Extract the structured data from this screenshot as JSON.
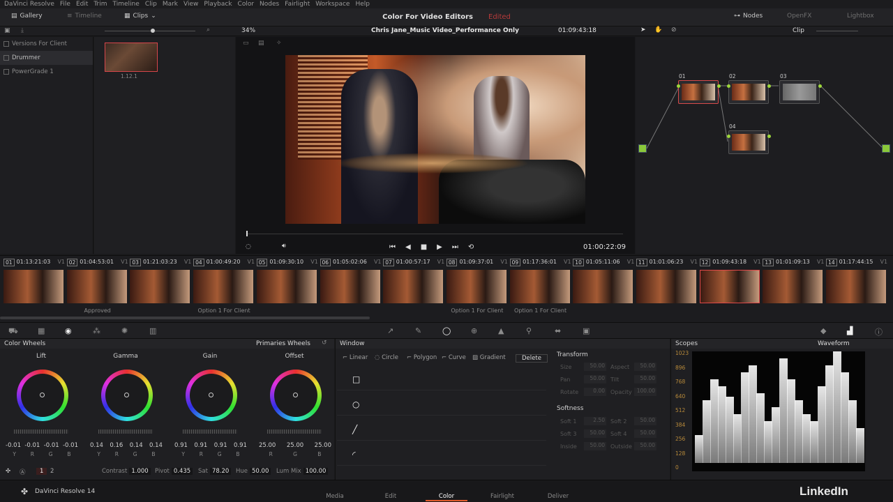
{
  "menubar": [
    "DaVinci Resolve",
    "File",
    "Edit",
    "Trim",
    "Timeline",
    "Clip",
    "Mark",
    "View",
    "Playback",
    "Color",
    "Nodes",
    "Fairlight",
    "Workspace",
    "Help"
  ],
  "toolbar": {
    "gallery": "Gallery",
    "timeline": "Timeline",
    "clips": "Clips",
    "project_title": "Color For Video Editors",
    "project_badge": "Edited",
    "nodes": "Nodes",
    "openfx": "OpenFX",
    "lightbox": "Lightbox"
  },
  "subbar": {
    "zoom": "34%",
    "timeline_name": "Chris Jane_Music Video_Performance Only",
    "timecode": "01:09:43:18",
    "node_mode": "Clip"
  },
  "gallery": {
    "albums": [
      "Versions For Client",
      "Drummer",
      "PowerGrade 1"
    ],
    "selected_album": "Drummer",
    "still_label": "1.12.1"
  },
  "viewer": {
    "timecode": "01:00:22:09"
  },
  "nodes": {
    "labels": [
      "01",
      "02",
      "03",
      "04"
    ]
  },
  "clips": [
    {
      "n": "01",
      "tc": "01:13:21:03",
      "v": "V1",
      "label": ""
    },
    {
      "n": "02",
      "tc": "01:04:53:01",
      "v": "V1",
      "label": "Approved"
    },
    {
      "n": "03",
      "tc": "01:21:03:23",
      "v": "V1",
      "label": ""
    },
    {
      "n": "04",
      "tc": "01:00:49:20",
      "v": "V1",
      "label": "Option 1 For Client"
    },
    {
      "n": "05",
      "tc": "01:09:30:10",
      "v": "V1",
      "label": ""
    },
    {
      "n": "06",
      "tc": "01:05:02:06",
      "v": "V1",
      "label": ""
    },
    {
      "n": "07",
      "tc": "01:00:57:17",
      "v": "V1",
      "label": ""
    },
    {
      "n": "08",
      "tc": "01:09:37:01",
      "v": "V1",
      "label": "Option 1 For Client"
    },
    {
      "n": "09",
      "tc": "01:17:36:01",
      "v": "V1",
      "label": "Option 1 For Client"
    },
    {
      "n": "10",
      "tc": "01:05:11:06",
      "v": "V1",
      "label": ""
    },
    {
      "n": "11",
      "tc": "01:01:06:23",
      "v": "V1",
      "label": ""
    },
    {
      "n": "12",
      "tc": "01:09:43:18",
      "v": "V1",
      "label": ""
    },
    {
      "n": "13",
      "tc": "01:01:09:13",
      "v": "V1",
      "label": ""
    },
    {
      "n": "14",
      "tc": "01:17:44:15",
      "v": "V1",
      "label": ""
    }
  ],
  "wheels_panel": {
    "title": "Color Wheels",
    "mode": "Primaries Wheels",
    "wheels": [
      {
        "name": "Lift",
        "values": [
          "-0.01",
          "-0.01",
          "-0.01",
          "-0.01"
        ]
      },
      {
        "name": "Gamma",
        "values": [
          "0.14",
          "0.16",
          "0.14",
          "0.14"
        ]
      },
      {
        "name": "Gain",
        "values": [
          "0.91",
          "0.91",
          "0.91",
          "0.91"
        ]
      },
      {
        "name": "Offset",
        "values": [
          "25.00",
          "25.00",
          "25.00"
        ]
      }
    ],
    "channels4": [
      "Y",
      "R",
      "G",
      "B"
    ],
    "channels3": [
      "R",
      "G",
      "B"
    ],
    "footer": {
      "page1": "1",
      "page2": "2",
      "contrast_label": "Contrast",
      "contrast": "1.000",
      "pivot_label": "Pivot",
      "pivot": "0.435",
      "sat_label": "Sat",
      "sat": "78.20",
      "hue_label": "Hue",
      "hue": "50.00",
      "lummix_label": "Lum Mix",
      "lummix": "100.00"
    }
  },
  "window_panel": {
    "title": "Window",
    "tabs": [
      "Linear",
      "Circle",
      "Polygon",
      "Curve",
      "Gradient"
    ],
    "delete": "Delete",
    "transform": "Transform",
    "softness": "Softness",
    "props": [
      {
        "l": "Size",
        "v": "50.00"
      },
      {
        "l": "Aspect",
        "v": "50.00"
      },
      {
        "l": "Pan",
        "v": "50.00"
      },
      {
        "l": "Tilt",
        "v": "50.00"
      },
      {
        "l": "Rotate",
        "v": "0.00"
      },
      {
        "l": "Opacity",
        "v": "100.00"
      },
      {
        "l": "Soft 1",
        "v": "2.50"
      },
      {
        "l": "Soft 2",
        "v": "50.00"
      },
      {
        "l": "Soft 3",
        "v": "50.00"
      },
      {
        "l": "Soft 4",
        "v": "50.00"
      },
      {
        "l": "Inside",
        "v": "50.00"
      },
      {
        "l": "Outside",
        "v": "50.00"
      }
    ]
  },
  "scopes": {
    "title": "Scopes",
    "mode": "Waveform",
    "ticks": [
      "1023",
      "896",
      "768",
      "640",
      "512",
      "384",
      "256",
      "128",
      "0"
    ]
  },
  "pages": [
    "Media",
    "Edit",
    "Color",
    "Fairlight",
    "Deliver"
  ],
  "active_page": "Color",
  "app_name": "DaVinci Resolve 14",
  "brand": "LinkedIn",
  "colors": {
    "accent": "#e05a2a",
    "selection": "#d8464b",
    "node_io": "#9ed83c",
    "scope_ticks": "#b88a3a"
  }
}
